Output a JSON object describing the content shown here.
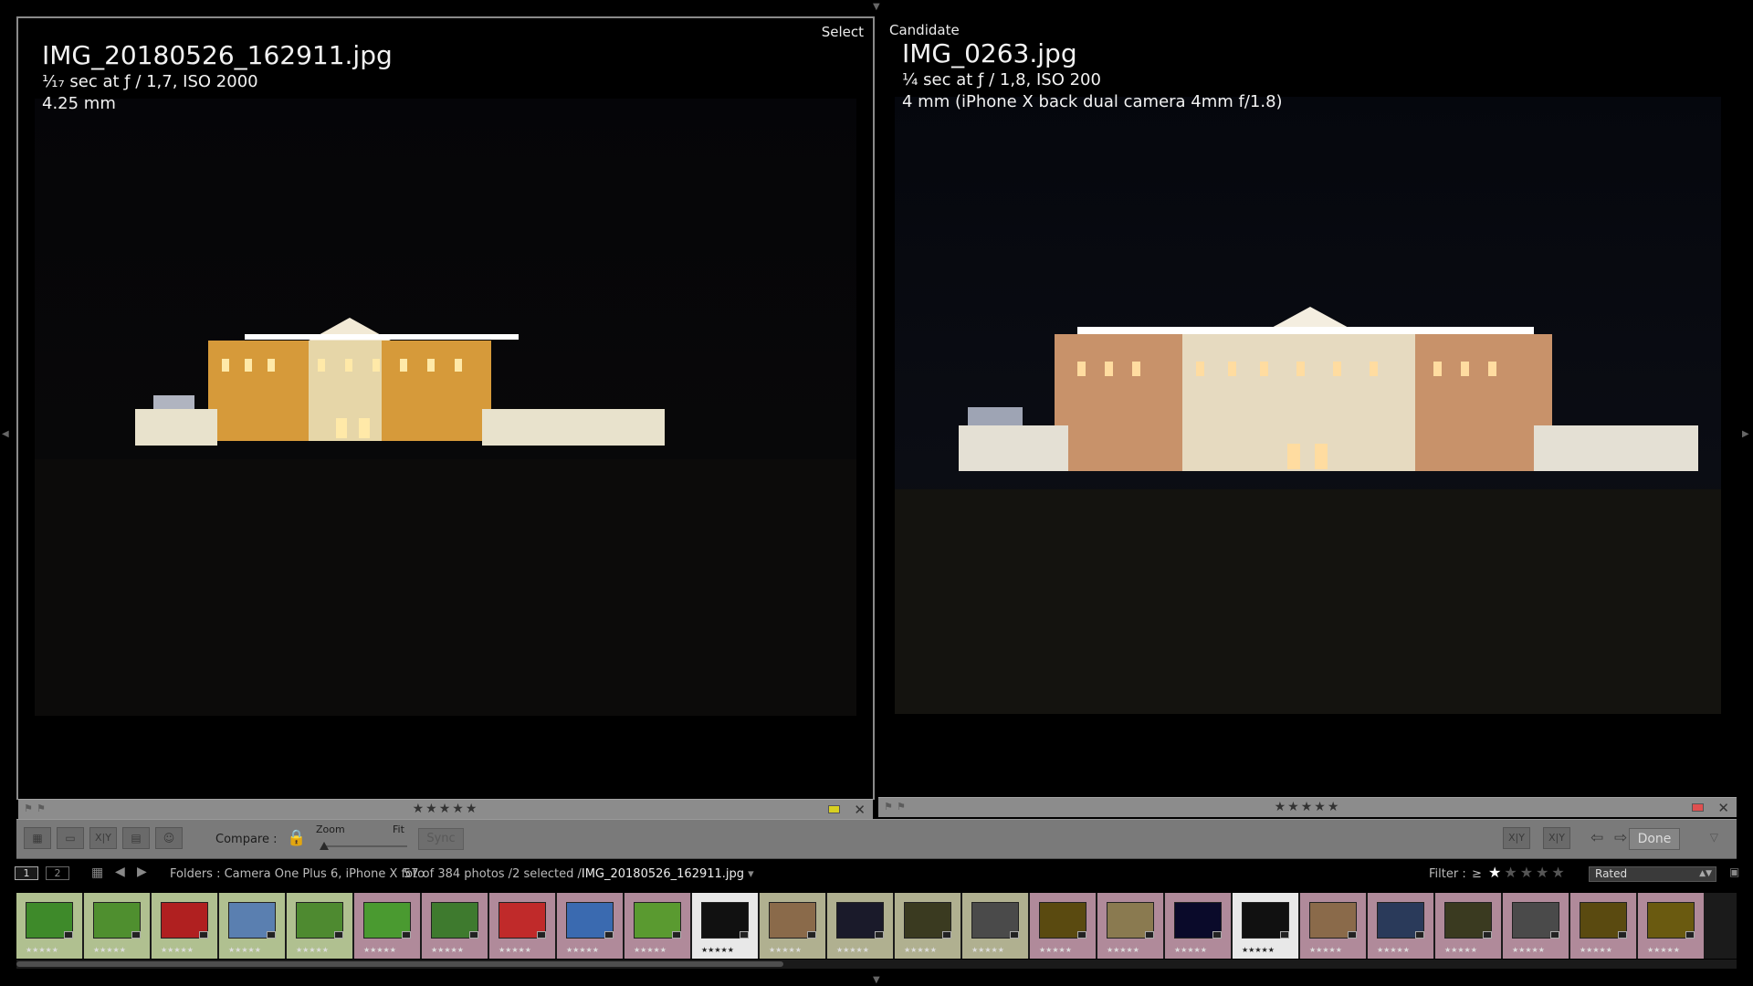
{
  "left_panel": {
    "label": "Select",
    "filename": "IMG_20180526_162911.jpg",
    "exposure": "¹⁄₁₇ sec at ƒ / 1,7, ISO 2000",
    "focal": "4.25 mm",
    "stars": "★★★★★",
    "color_label": "#d8d020"
  },
  "right_panel": {
    "label": "Candidate",
    "filename": "IMG_0263.jpg",
    "exposure": "¼ sec at ƒ / 1,8, ISO 200",
    "focal": "4 mm (iPhone X back dual camera 4mm f/1.8)",
    "stars": "★★★★★",
    "color_label": "#e05050"
  },
  "toolbar": {
    "compare_label": "Compare :",
    "zoom_label": "Zoom",
    "fit_label": "Fit",
    "sync_label": "Sync",
    "done_label": "Done",
    "xy_label": "X|Y"
  },
  "filmstrip_header": {
    "page1": "1",
    "page2": "2",
    "folders": "Folders : Camera One Plus 6, iPhone X foto",
    "count": "57 of 384 photos /2 selected /",
    "current_file": "IMG_20180526_162911.jpg",
    "filter_label": "Filter :",
    "filter_op": "≥",
    "filter_stars": "★★★★★",
    "rated_option": "Rated"
  },
  "filmstrip": {
    "thumbs": [
      {
        "stars": "★★★★★",
        "color": "#3e8a2a",
        "bg": "#b0c090"
      },
      {
        "stars": "★★★★★",
        "color": "#4f8f2f",
        "bg": "#b0c090"
      },
      {
        "stars": "★★★★★",
        "color": "#b02020",
        "bg": "#b0c090"
      },
      {
        "stars": "★★★★★",
        "color": "#5a7fb0",
        "bg": "#b0c090"
      },
      {
        "stars": "★★★★★",
        "color": "#4e8a30",
        "bg": "#b0c090"
      },
      {
        "stars": "★★★★★",
        "color": "#4a9a30",
        "bg": "#b08a9a"
      },
      {
        "stars": "★★★★★",
        "color": "#3e7a2e",
        "bg": "#b08a9a"
      },
      {
        "stars": "★★★★★",
        "color": "#c02a2a",
        "bg": "#b08a9a"
      },
      {
        "stars": "★★★★★",
        "color": "#3a6ab0",
        "bg": "#b08a9a"
      },
      {
        "stars": "★★★★★",
        "color": "#5a9a30",
        "bg": "#b08a9a"
      },
      {
        "stars": "★★★★★",
        "color": "#111111",
        "bg": "#e8e8e8",
        "selected": true
      },
      {
        "stars": "★★★★★",
        "color": "#8a6a4a",
        "bg": "#b0b090"
      },
      {
        "stars": "★★★★★",
        "color": "#1a1a2a",
        "bg": "#b0b090"
      },
      {
        "stars": "★★★★★",
        "color": "#3a3a20",
        "bg": "#b0b090"
      },
      {
        "stars": "★★★★★",
        "color": "#4a4a4a",
        "bg": "#b0b090"
      },
      {
        "stars": "★★★★★",
        "color": "#5a4a10",
        "bg": "#b08a9a"
      },
      {
        "stars": "★★★★★",
        "color": "#8a7a50",
        "bg": "#b08a9a"
      },
      {
        "stars": "★★★★★",
        "color": "#0a0a2a",
        "bg": "#b08a9a"
      },
      {
        "stars": "★★★★★",
        "color": "#111111",
        "bg": "#e8e8e8",
        "selected": true
      },
      {
        "stars": "★★★★★",
        "color": "#8a6a4a",
        "bg": "#b08a9a"
      },
      {
        "stars": "★★★★★",
        "color": "#2a3a5a",
        "bg": "#b08a9a"
      },
      {
        "stars": "★★★★★",
        "color": "#3a3a20",
        "bg": "#b08a9a"
      },
      {
        "stars": "★★★★★",
        "color": "#4a4a4a",
        "bg": "#b08a9a"
      },
      {
        "stars": "★★★★★",
        "color": "#5a4a10",
        "bg": "#b08a9a"
      },
      {
        "stars": "★★★★★",
        "color": "#6a5a10",
        "bg": "#b08a9a"
      }
    ]
  }
}
